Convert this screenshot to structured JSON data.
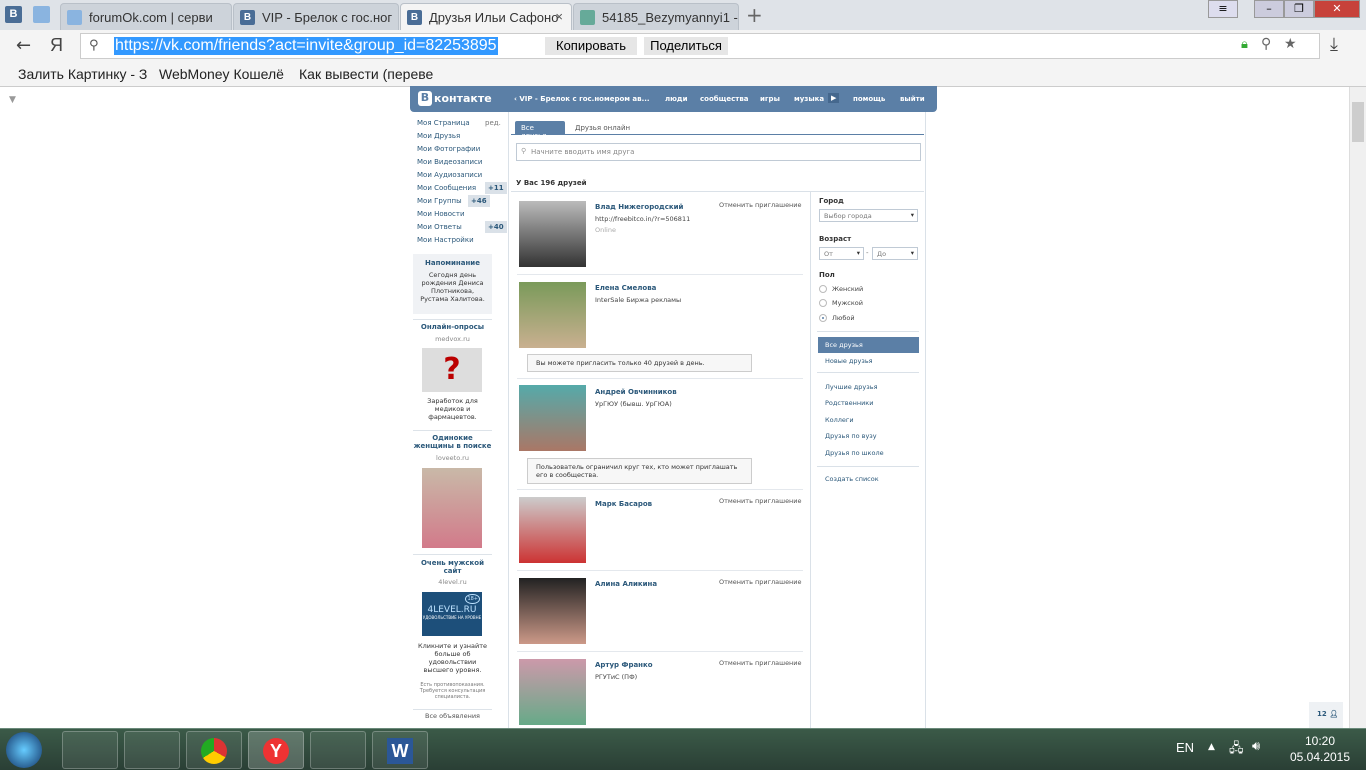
{
  "browser": {
    "tabs": [
      {
        "label": "forumOk.com | серви"
      },
      {
        "label": "VIP - Брелок с гос.ног"
      },
      {
        "label": "Друзья Ильи Сафоно"
      },
      {
        "label": "54185_Bezymyannyi1 -"
      }
    ],
    "url": "https://vk.com/friends?act=invite&group_id=82253895",
    "copy_label": "Копировать",
    "share_label": "Поделиться",
    "yandex_label": "Я",
    "bookmarks": [
      "Залить Картинку - З",
      "WebMoney Кошелё",
      "Как вывести (переве"
    ]
  },
  "vk": {
    "logo": "контакте",
    "nav": {
      "group": "VIP - Брелок с гос.номером ав...",
      "people": "люди",
      "communities": "сообщества",
      "games": "игры",
      "music": "музыка",
      "help": "помощь",
      "logout": "выйти"
    },
    "left_menu": [
      {
        "label": "Моя Страница",
        "extra": "ред."
      },
      {
        "label": "Мои Друзья"
      },
      {
        "label": "Мои Фотографии"
      },
      {
        "label": "Мои Видеозаписи"
      },
      {
        "label": "Мои Аудиозаписи"
      },
      {
        "label": "Мои Сообщения",
        "badge": "+11"
      },
      {
        "label": "Мои Группы",
        "badge": "+46"
      },
      {
        "label": "Мои Новости"
      },
      {
        "label": "Мои Ответы",
        "badge": "+40"
      },
      {
        "label": "Мои Настройки"
      }
    ],
    "reminder": {
      "title": "Напоминание",
      "text": "Сегодня день рождения Дениса Плотникова, Рустама Халитова."
    },
    "ads": [
      {
        "title": "Онлайн-опросы",
        "domain": "medvox.ru",
        "text": "Заработок для медиков и фармацевтов."
      },
      {
        "title": "Одинокие женщины в поиске",
        "domain": "loveeto.ru"
      },
      {
        "title": "Очень мужской сайт",
        "domain": "4level.ru",
        "banner": "4LEVEL.RU",
        "banner_sub": "УДОВОЛЬСТВИЕ НА УРОВНЕ",
        "banner_age": "18+",
        "text": "Кликните и узнайте больше об удовольствии высшего уровня.",
        "disclaimer": "Есть противопоказания. Требуется консультация специалиста."
      }
    ],
    "all_ads": "Все объявления",
    "tabs": {
      "all": "Все друзья",
      "online": "Друзья онлайн"
    },
    "search_placeholder": "Начните вводить имя друга",
    "count_text": "У Вас 196 друзей",
    "cancel_label": "Отменить приглашение",
    "friends": [
      {
        "name": "Влад Нижегородский",
        "sub": "http://freebitco.in/?r=506811",
        "status": "Online",
        "invited": true
      },
      {
        "name": "Елена Смелова",
        "sub": "InterSale Биржа рекламы",
        "note": "Вы можете пригласить только 40 друзей в день."
      },
      {
        "name": "Андрей Овчинников",
        "sub": "УрГЮУ (бывш. УрГЮА)",
        "note": "Пользователь ограничил круг тех, кто может приглашать его в сообщества."
      },
      {
        "name": "Марк Басаров",
        "invited": true
      },
      {
        "name": "Алина Аликина",
        "invited": true
      },
      {
        "name": "Артур Франко",
        "sub": "РГУТиС (ПФ)",
        "invited": true
      }
    ],
    "filters": {
      "city_label": "Город",
      "city_value": "Выбор города",
      "age_label": "Возраст",
      "age_from": "От",
      "age_to": "До",
      "sex_label": "Пол",
      "sex_options": [
        "Женский",
        "Мужской",
        "Любой"
      ],
      "sex_selected": 2
    },
    "lists": [
      "Все друзья",
      "Новые друзья",
      "Лучшие друзья",
      "Родственники",
      "Коллеги",
      "Друзья по вузу",
      "Друзья по школе",
      "Создать список"
    ],
    "online_count": "12"
  },
  "taskbar": {
    "lang": "EN",
    "time": "10:20",
    "date": "05.04.2015"
  }
}
